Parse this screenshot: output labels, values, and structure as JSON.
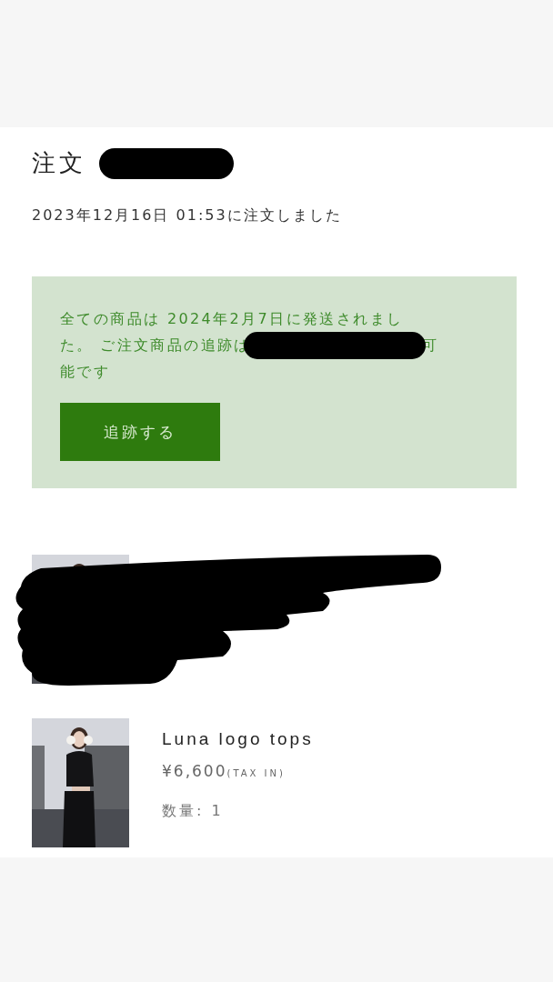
{
  "order": {
    "title": "注文",
    "number_redacted": true,
    "date": "2023年12月16日 01:53に注文しました"
  },
  "notice": {
    "lines": [
      [
        {
          "kind": "text",
          "text": "全ての商品は 2024年2月7日に発送されまし"
        }
      ],
      [
        {
          "kind": "text",
          "text": "た。 ご注文商品の追跡は"
        },
        {
          "kind": "redaction"
        },
        {
          "kind": "text",
          "text": "可"
        }
      ],
      [
        {
          "kind": "text",
          "text": "能です"
        }
      ]
    ],
    "button": "追跡する"
  },
  "items": [
    {
      "kind": "redacted"
    },
    {
      "kind": "product",
      "name": "Luna logo tops",
      "price": "¥6,600",
      "tax": "(TAX IN)",
      "quantity": "数量: 1"
    }
  ]
}
